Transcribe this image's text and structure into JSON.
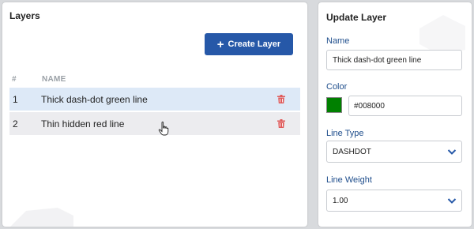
{
  "layers_panel": {
    "title": "Layers",
    "create_button_label": "Create Layer",
    "columns": {
      "hash": "#",
      "name": "NAME"
    },
    "rows": [
      {
        "num": "1",
        "name": "Thick dash-dot green line"
      },
      {
        "num": "2",
        "name": "Thin hidden red line"
      }
    ]
  },
  "update_panel": {
    "title": "Update Layer",
    "name_label": "Name",
    "name_value": "Thick dash-dot green line",
    "color_label": "Color",
    "color_value": "#008000",
    "line_type_label": "Line Type",
    "line_type_value": "DASHDOT",
    "line_weight_label": "Line Weight",
    "line_weight_value": "1.00"
  },
  "colors": {
    "accent": "#2658a8",
    "selected_row": "#dde9f7",
    "delete_icon": "#e05a5a",
    "label_blue": "#1f4e8c",
    "swatch": "#008000"
  }
}
